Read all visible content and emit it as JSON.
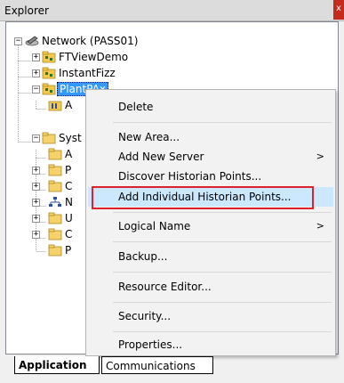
{
  "window": {
    "title": "Explorer",
    "close_label": "x"
  },
  "tree": {
    "items": [
      {
        "label": "Network (PASS01)",
        "icon": "network-icon",
        "expanded": true
      },
      {
        "label": "FTViewDemo",
        "icon": "app-folder-icon",
        "expanded": false
      },
      {
        "label": "InstantFizz",
        "icon": "app-folder-icon",
        "expanded": false
      },
      {
        "label": "PlantPAx",
        "icon": "app-folder-icon",
        "expanded": true,
        "selected": true
      },
      {
        "label": "A",
        "icon": "area-icon"
      },
      {
        "label": "Syst",
        "icon": "folder-icon",
        "expanded": true
      },
      {
        "label": "A",
        "icon": "folder-icon"
      },
      {
        "label": "P",
        "icon": "folder-icon"
      },
      {
        "label": "C",
        "icon": "folder-icon"
      },
      {
        "label": "N",
        "icon": "network-node-icon"
      },
      {
        "label": "U",
        "icon": "folder-icon"
      },
      {
        "label": "C",
        "icon": "folder-icon"
      },
      {
        "label": "P",
        "icon": "folder-icon"
      }
    ]
  },
  "context_menu": {
    "items": [
      {
        "label": "Delete",
        "submenu": false
      },
      {
        "label": "New Area...",
        "submenu": false
      },
      {
        "label": "Add New Server",
        "submenu": true
      },
      {
        "label": "Discover Historian Points...",
        "submenu": false
      },
      {
        "label": "Add Individual Historian Points...",
        "submenu": false,
        "hovered": true
      },
      {
        "label": "Logical Name",
        "submenu": true
      },
      {
        "label": "Backup...",
        "submenu": false
      },
      {
        "label": "Resource Editor...",
        "submenu": false
      },
      {
        "label": "Security...",
        "submenu": false
      },
      {
        "label": "Properties...",
        "submenu": false
      }
    ],
    "submenu_arrow": ">"
  },
  "tabs": {
    "items": [
      {
        "label": "Application",
        "active": true
      },
      {
        "label": "Communications",
        "active": false
      }
    ]
  },
  "colors": {
    "selection": "#3399ff",
    "menu_hover": "#cce8ff",
    "highlight_border": "#e0202a",
    "close_button": "#c42b1c"
  }
}
